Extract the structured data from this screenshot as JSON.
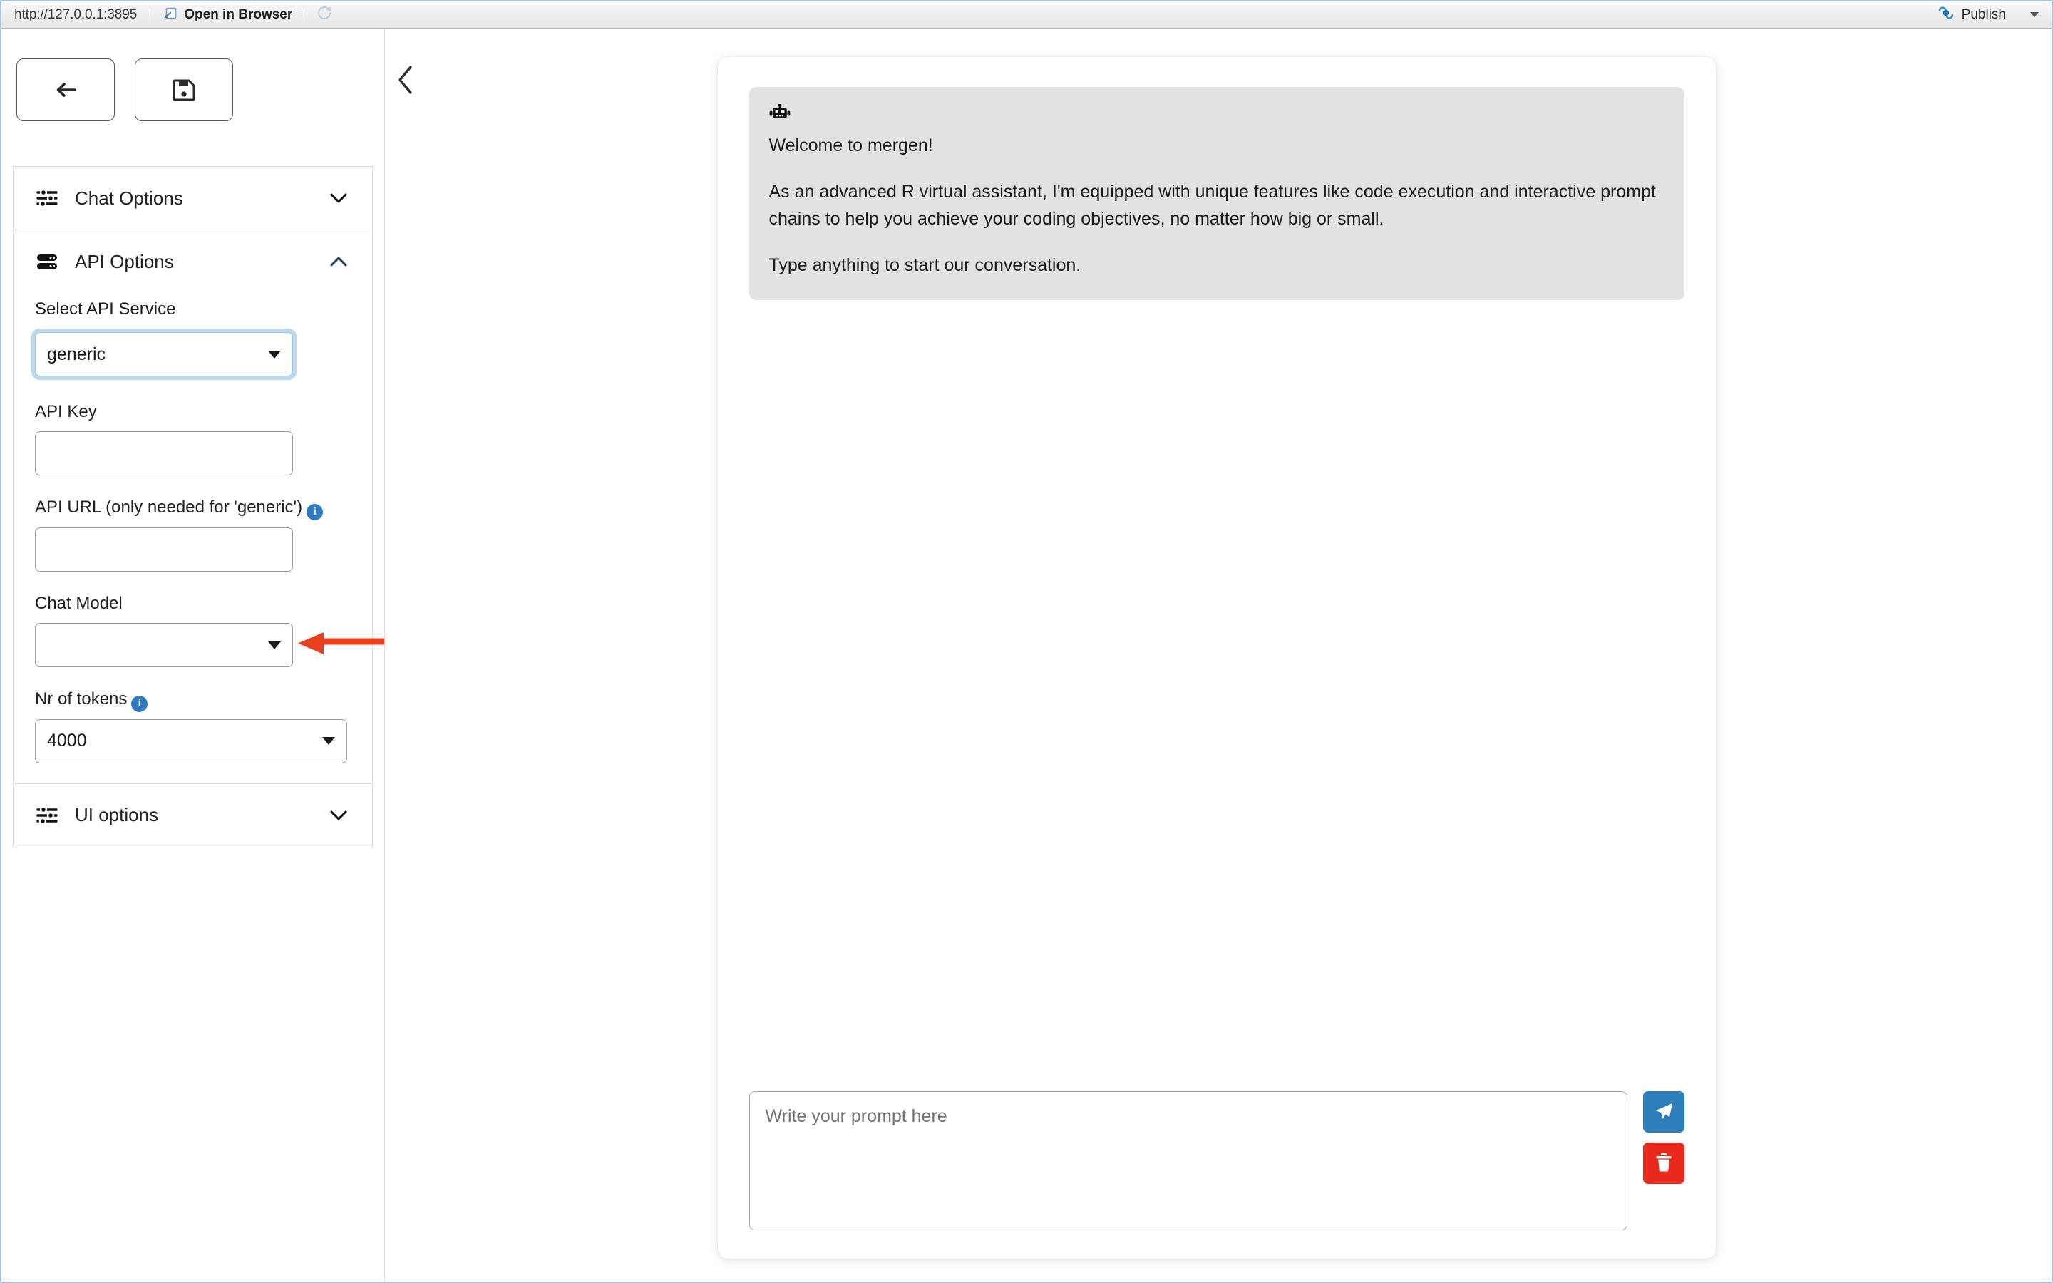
{
  "viewer": {
    "url": "http://127.0.0.1:3895",
    "open_in_browser_label": "Open in Browser",
    "refresh_icon": "refresh-icon",
    "publish_label": "Publish",
    "publish_icon": "publish-icon",
    "open_in_browser_icon": "external-window-icon"
  },
  "colors": {
    "accent_blue": "#2e7ebb",
    "danger_red": "#e8291c",
    "annotation_arrow": "#e8401f",
    "info_badge": "#2b7cc4",
    "focus_ring": "#bcd9ef",
    "bubble_grey": "#e2e2e2"
  },
  "sidebar": {
    "toolbar_buttons": [
      {
        "name": "back-button",
        "icon": "arrow-left-icon"
      },
      {
        "name": "save-button",
        "icon": "floppy-disk-save-icon"
      }
    ],
    "collapse_toggle_icon": "chevron-left-icon",
    "panels": [
      {
        "label": "Chat Options",
        "icon": "sliders-icon",
        "expanded": false,
        "chevron": "chevron-down-icon"
      },
      {
        "label": "API Options",
        "icon": "server-icon",
        "expanded": true,
        "chevron": "chevron-up-icon"
      },
      {
        "label": "UI options",
        "icon": "sliders-icon",
        "expanded": false,
        "chevron": "chevron-down-icon"
      }
    ],
    "api_options": {
      "select_api_service": {
        "label": "Select API Service",
        "value": "generic",
        "focused": true,
        "options": [
          "generic"
        ]
      },
      "api_key": {
        "label": "API Key",
        "value": ""
      },
      "api_url": {
        "label": "API URL (only needed for 'generic')",
        "info_icon": "info-icon",
        "value": ""
      },
      "chat_model": {
        "label": "Chat Model",
        "value": "",
        "options": []
      },
      "nr_of_tokens": {
        "label": "Nr of tokens",
        "info_icon": "info-icon",
        "value": "4000",
        "options": [
          "4000"
        ]
      }
    }
  },
  "chat": {
    "message": {
      "avatar_icon": "robot-icon",
      "lines": [
        "Welcome to mergen!",
        "As an advanced R virtual assistant, I'm equipped with unique features like code execution and interactive prompt chains to help you achieve your coding objectives, no matter how big or small.",
        "Type anything to start our conversation."
      ]
    },
    "composer": {
      "placeholder": "Write your prompt here",
      "value": "",
      "send_icon": "paper-plane-send-icon",
      "clear_icon": "trash-delete-icon"
    }
  },
  "annotation": {
    "arrow_icon": "arrow-left-annotation",
    "points_at": "api-url-input"
  }
}
